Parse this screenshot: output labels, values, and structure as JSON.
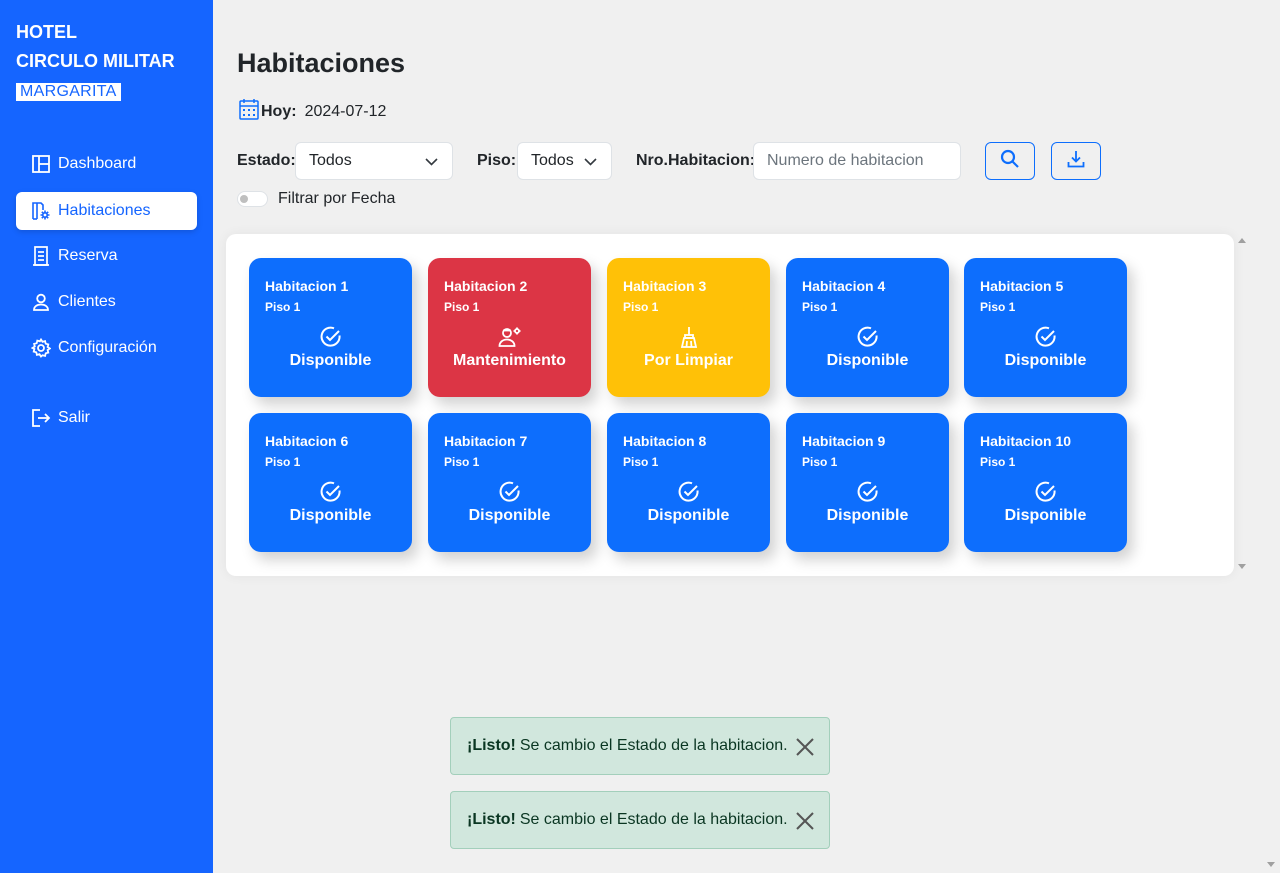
{
  "brand": {
    "line1": "HOTEL",
    "line2": "CIRCULO MILITAR",
    "line3": "MARGARITA"
  },
  "nav": [
    {
      "label": "Dashboard",
      "icon": "layout-icon"
    },
    {
      "label": "Habitaciones",
      "icon": "room-settings-icon",
      "active": true
    },
    {
      "label": "Reserva",
      "icon": "receipt-icon"
    },
    {
      "label": "Clientes",
      "icon": "user-icon"
    },
    {
      "label": "Configuración",
      "icon": "gear-icon"
    },
    {
      "label": "Salir",
      "icon": "logout-icon"
    }
  ],
  "page": {
    "title": "Habitaciones",
    "today_label": "Hoy:",
    "today_value": "2024-07-12"
  },
  "filters": {
    "estado_label": "Estado:",
    "estado_value": "Todos",
    "piso_label": "Piso:",
    "piso_value": "Todos",
    "nro_label": "Nro.Habitacion:",
    "nro_placeholder": "Numero de habitacion",
    "date_toggle_label": "Filtrar por Fecha"
  },
  "colors": {
    "primary": "#1565ff",
    "disponible": "#0d6efd",
    "mantenimiento": "#dc3545",
    "por_limpiar": "#ffc107"
  },
  "rooms": [
    {
      "name": "Habitacion 1",
      "floor": "Piso 1",
      "status": "Disponible",
      "status_icon": "check-circle-icon"
    },
    {
      "name": "Habitacion 2",
      "floor": "Piso 1",
      "status": "Mantenimiento",
      "status_icon": "maintenance-icon"
    },
    {
      "name": "Habitacion 3",
      "floor": "Piso 1",
      "status": "Por Limpiar",
      "status_icon": "broom-icon"
    },
    {
      "name": "Habitacion 4",
      "floor": "Piso 1",
      "status": "Disponible",
      "status_icon": "check-circle-icon"
    },
    {
      "name": "Habitacion 5",
      "floor": "Piso 1",
      "status": "Disponible",
      "status_icon": "check-circle-icon"
    },
    {
      "name": "Habitacion 6",
      "floor": "Piso 1",
      "status": "Disponible",
      "status_icon": "check-circle-icon"
    },
    {
      "name": "Habitacion 7",
      "floor": "Piso 1",
      "status": "Disponible",
      "status_icon": "check-circle-icon"
    },
    {
      "name": "Habitacion 8",
      "floor": "Piso 1",
      "status": "Disponible",
      "status_icon": "check-circle-icon"
    },
    {
      "name": "Habitacion 9",
      "floor": "Piso 1",
      "status": "Disponible",
      "status_icon": "check-circle-icon"
    },
    {
      "name": "Habitacion 10",
      "floor": "Piso 1",
      "status": "Disponible",
      "status_icon": "check-circle-icon"
    }
  ],
  "toasts": [
    {
      "strong": "¡Listo!",
      "text": "Se cambio el Estado de la habitacion."
    },
    {
      "strong": "¡Listo!",
      "text": "Se cambio el Estado de la habitacion."
    }
  ]
}
